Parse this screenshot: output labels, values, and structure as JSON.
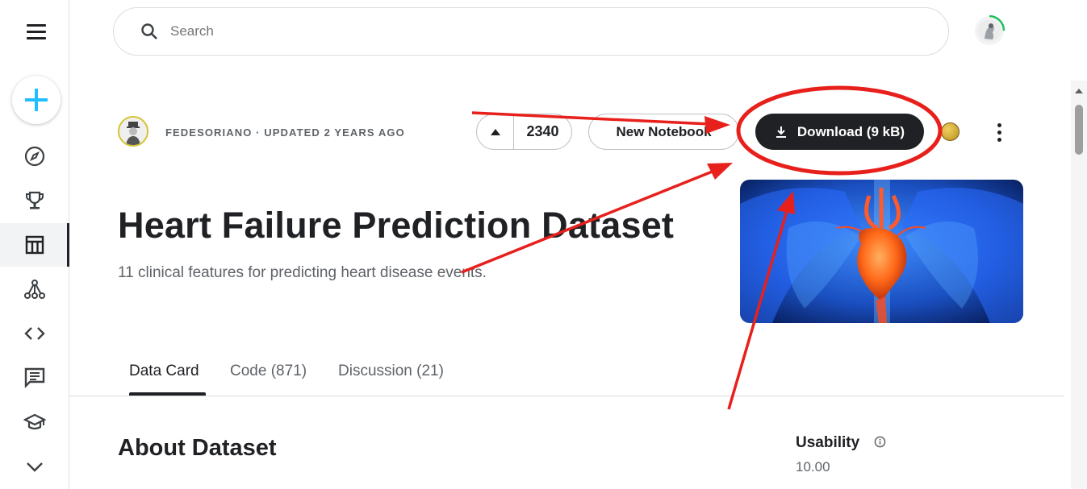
{
  "search": {
    "placeholder": "Search"
  },
  "sidebar": {
    "items": [
      {
        "name": "explore",
        "icon": "compass-icon"
      },
      {
        "name": "competitions",
        "icon": "trophy-icon"
      },
      {
        "name": "datasets",
        "icon": "table-icon",
        "active": true
      },
      {
        "name": "models",
        "icon": "models-icon"
      },
      {
        "name": "code",
        "icon": "code-icon"
      },
      {
        "name": "discussions",
        "icon": "comment-icon"
      },
      {
        "name": "learn",
        "icon": "school-icon"
      },
      {
        "name": "more",
        "icon": "chevron-down-icon"
      }
    ]
  },
  "dataset": {
    "owner_line": "FEDESORIANO · UPDATED 2 YEARS AGO",
    "upvotes": "2340",
    "new_notebook_label": "New Notebook",
    "download_label": "Download (9 kB)",
    "title": "Heart Failure Prediction Dataset",
    "subtitle": "11 clinical features for predicting heart disease events."
  },
  "tabs": [
    {
      "label": "Data Card",
      "active": true
    },
    {
      "label": "Code (871)"
    },
    {
      "label": "Discussion (21)"
    }
  ],
  "about": {
    "heading": "About Dataset"
  },
  "usability": {
    "label": "Usability",
    "value": "10.00"
  },
  "colors": {
    "annotation": "#e8201c",
    "accent_plus": "#20beff",
    "dark_button": "#202124",
    "medal_gold": "#d4a82a"
  }
}
